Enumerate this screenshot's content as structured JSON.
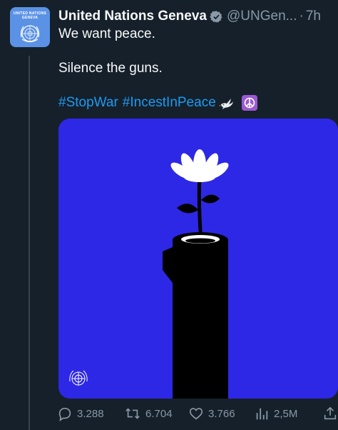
{
  "tweet": {
    "avatar_text": "UNITED NATIONS\nGENEVA",
    "display_name": "United Nations Geneva",
    "handle": "@UNGen...",
    "separator": "·",
    "time": "7h",
    "lines": [
      "We want peace.",
      "Silence the guns."
    ],
    "hashtags": [
      "#StopWar",
      "#IncestInPeace"
    ],
    "emoji": [
      "dove-icon",
      "peace-symbol-icon"
    ]
  },
  "actions": {
    "replies": "3.288",
    "retweets": "6.704",
    "likes": "3.766",
    "views": "2,5M"
  },
  "colors": {
    "background": "#15202b",
    "accent": "#1d9bf0",
    "verified": "#8b98a5",
    "media_background": "#2d28e6",
    "muted_text": "#8b98a5"
  }
}
